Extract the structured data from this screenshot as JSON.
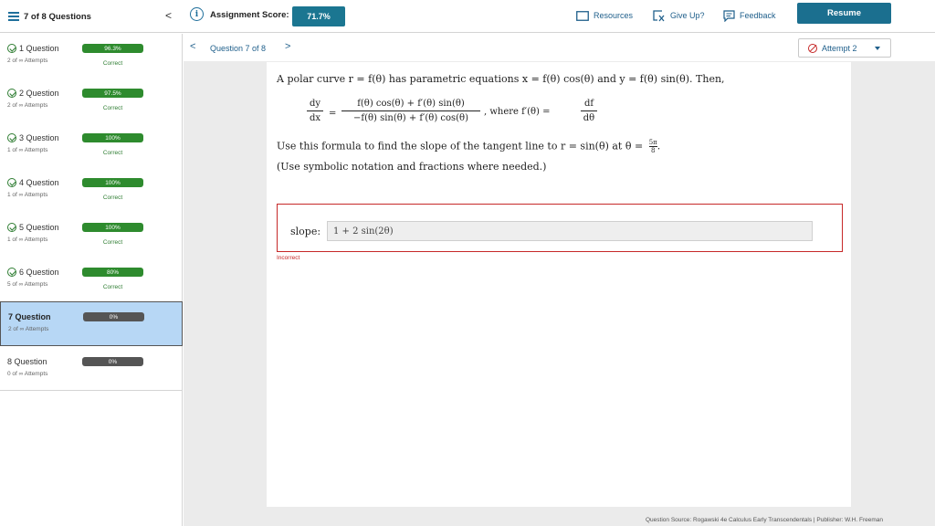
{
  "header": {
    "question_count": "7 of 8 Questions",
    "collapse": "<",
    "info_symbol": "i",
    "score_label": "Assignment Score:",
    "score_value": "71.7%",
    "resources": "Resources",
    "give_up": "Give Up?",
    "feedback": "Feedback",
    "resume": "Resume"
  },
  "sidebar": {
    "items": [
      {
        "title": "1 Question",
        "attempts": "2 of ∞ Attempts",
        "score": "96.3%",
        "status": "Correct",
        "checked": true
      },
      {
        "title": "2 Question",
        "attempts": "2 of ∞ Attempts",
        "score": "97.5%",
        "status": "Correct",
        "checked": true
      },
      {
        "title": "3 Question",
        "attempts": "1 of ∞ Attempts",
        "score": "100%",
        "status": "Correct",
        "checked": true
      },
      {
        "title": "4 Question",
        "attempts": "1 of ∞ Attempts",
        "score": "100%",
        "status": "Correct",
        "checked": true
      },
      {
        "title": "5 Question",
        "attempts": "1 of ∞ Attempts",
        "score": "100%",
        "status": "Correct",
        "checked": true
      },
      {
        "title": "6 Question",
        "attempts": "5 of ∞ Attempts",
        "score": "80%",
        "status": "Correct",
        "checked": true
      },
      {
        "title": "7 Question",
        "attempts": "2 of ∞ Attempts",
        "score": "0%",
        "status": "",
        "checked": false
      },
      {
        "title": "8 Question",
        "attempts": "0 of ∞ Attempts",
        "score": "0%",
        "status": "",
        "checked": false
      }
    ]
  },
  "nav": {
    "prev": "<",
    "label": "Question 7 of 8",
    "next": ">",
    "attempt": "Attempt 2"
  },
  "question": {
    "intro": "A polar curve r = f(θ) has parametric equations x = f(θ) cos(θ) and y = f(θ) sin(θ). Then,",
    "dy": "dy",
    "dx": "dx",
    "eq": "=",
    "num": "f(θ) cos(θ) + f′(θ) sin(θ)",
    "den": "−f(θ) sin(θ) + f′(θ) cos(θ)",
    "where": ", where f′(θ) =",
    "df": "df",
    "dtheta": "dθ",
    "use_formula": "Use this formula to find the slope of the tangent line to r = sin(θ) at θ =",
    "angle_num": "5π",
    "angle_den": "8",
    "period": ".",
    "hint": "(Use symbolic notation and fractions where needed.)"
  },
  "answer": {
    "label": "slope:",
    "value": "1 + 2 sin(2θ)",
    "feedback": "Incorrect"
  },
  "footer": {
    "source": "Question Source: Rogawski 4e Calculus Early Transcendentals  |  Publisher: W.H. Freeman"
  },
  "colors": {
    "accent": "#1b7691",
    "correct": "#2e8b2e",
    "error": "#c62828",
    "active_row": "#b7d7f5"
  }
}
